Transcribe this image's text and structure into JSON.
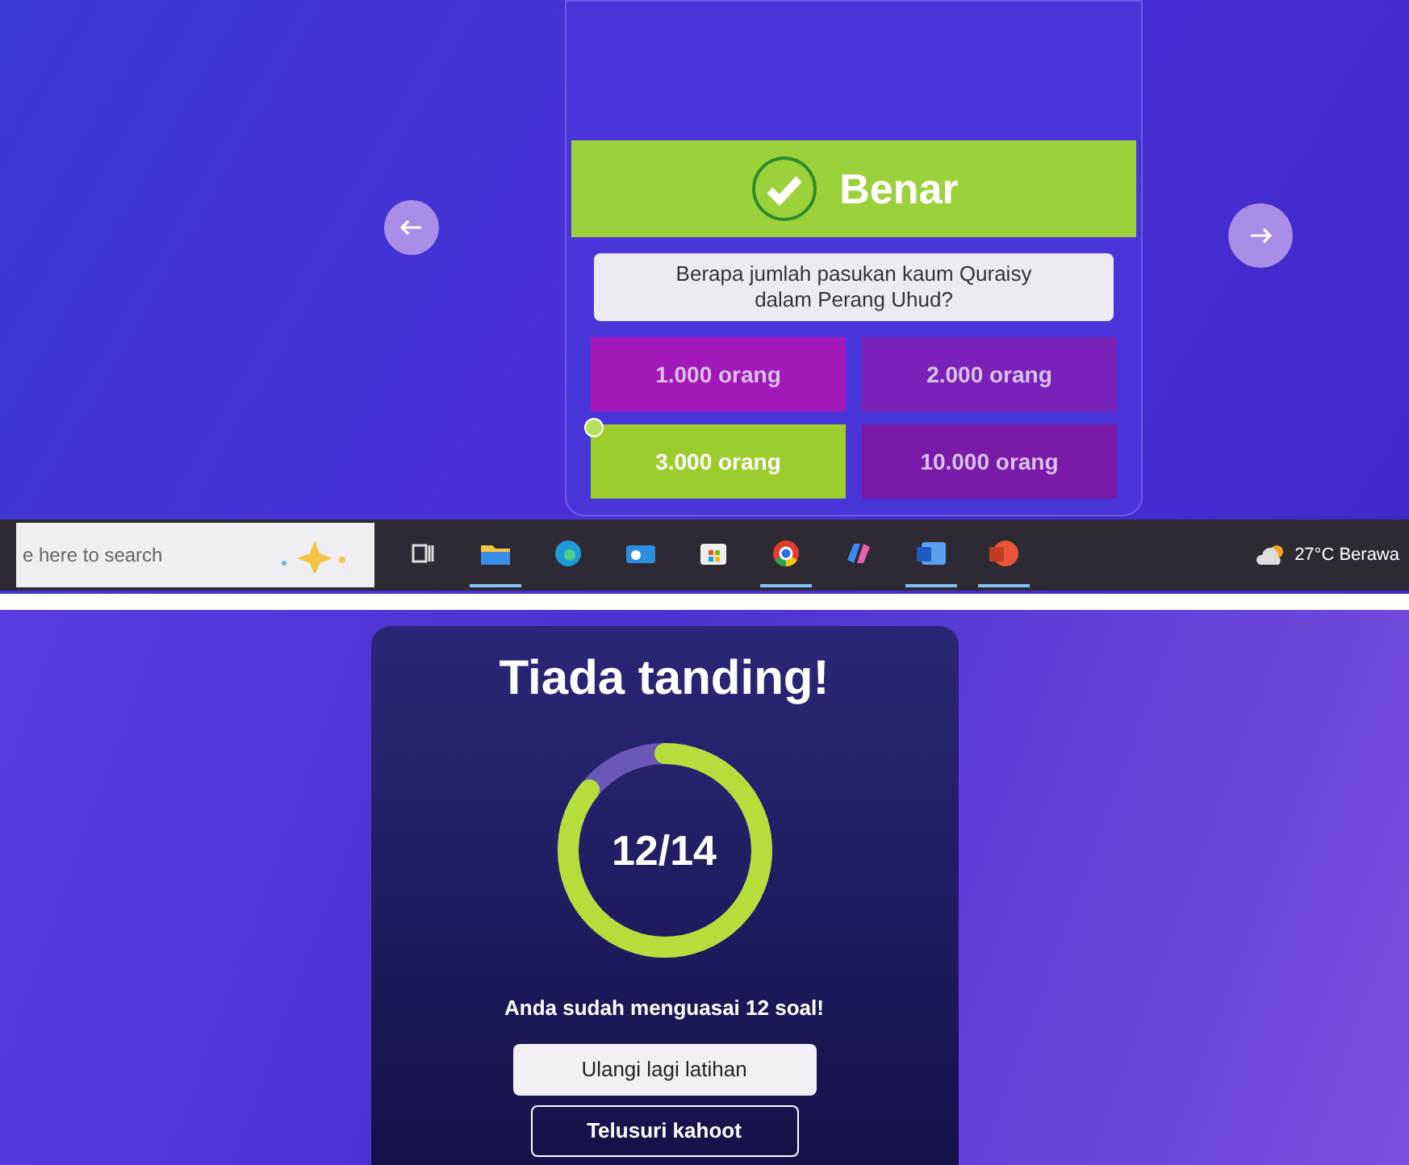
{
  "quiz_screen": {
    "result": {
      "label": "Benar",
      "correct": true
    },
    "question": "Berapa jumlah pasukan kaum Quraisy dalam Perang Uhud?",
    "answers": [
      {
        "label": "1.000 orang",
        "selected": false,
        "color": "#a318b8"
      },
      {
        "label": "2.000 orang",
        "selected": false,
        "color": "#7a22b8"
      },
      {
        "label": "3.000 orang",
        "selected": true,
        "color": "#9ccd2f"
      },
      {
        "label": "10.000 orang",
        "selected": false,
        "color": "#7a1aa8"
      }
    ]
  },
  "taskbar": {
    "search": {
      "placeholder": "e here to search"
    },
    "apps": [
      {
        "kind": "taskview",
        "selected": false
      },
      {
        "kind": "folder",
        "selected": true
      },
      {
        "kind": "edge",
        "selected": false
      },
      {
        "kind": "outlook",
        "selected": false
      },
      {
        "kind": "store",
        "selected": false
      },
      {
        "kind": "chrome",
        "selected": true
      },
      {
        "kind": "copilot",
        "selected": false
      },
      {
        "kind": "word",
        "selected": true
      },
      {
        "kind": "powerpoint",
        "selected": true
      }
    ],
    "weather": "27°C Berawa"
  },
  "result_screen": {
    "title": "Tiada tanding!",
    "score": "12/14",
    "level": 0.857,
    "message": "Anda sudah menguasai **12** soal!",
    "buttons": [
      {
        "label": "Ulangi lagi latihan",
        "kind": "primary"
      },
      {
        "label": "Telusuri kahoot",
        "kind": "outline"
      }
    ]
  }
}
